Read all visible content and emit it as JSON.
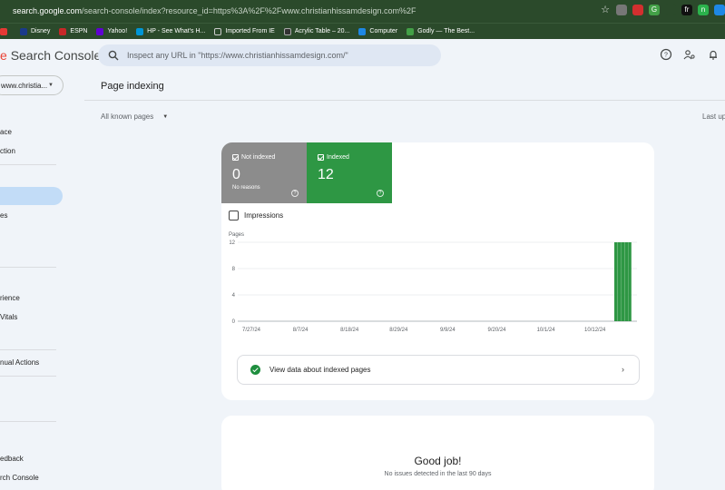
{
  "browser": {
    "url_host": "search.google.com",
    "url_rest": "/search-console/index?resource_id=https%3A%2F%2Fwww.christianhissamdesign.com%2F",
    "bookmarks": [
      {
        "label": "Disney",
        "color": "#1a3a8a"
      },
      {
        "label": "ESPN",
        "color": "#c62828"
      },
      {
        "label": "Yahoo!",
        "color": "#6001d2"
      },
      {
        "label": "HP - See What's H...",
        "color": "#0096d6"
      },
      {
        "label": "Imported From IE",
        "color": "#9aa0a6"
      },
      {
        "label": "Acrylic Table – 20...",
        "color": "#333333"
      },
      {
        "label": "Computer",
        "color": "#1e88e5"
      },
      {
        "label": "Godly — The Best...",
        "color": "#43a047"
      }
    ]
  },
  "header": {
    "app_name": "Search Console",
    "search_placeholder": "Inspect any URL in \"https://www.christianhissamdesign.com/\""
  },
  "sidebar": {
    "property": "www.christia...",
    "items": [
      "ace",
      "ction",
      "es",
      "rience",
      "Vitals",
      "nual Actions",
      "edback",
      "rch Console"
    ]
  },
  "main": {
    "page_title": "Page indexing",
    "filter_label": "All known pages",
    "last_updated_label": "Last up",
    "tiles": {
      "not_indexed": {
        "label": "Not indexed",
        "value": "0",
        "sub": "No reasons"
      },
      "indexed": {
        "label": "Indexed",
        "value": "12"
      }
    },
    "impressions_label": "Impressions",
    "view_data_label": "View data about indexed pages",
    "good_job": "Good job!",
    "no_issues": "No issues detected in the last 90 days"
  },
  "colors": {
    "indexed_green": "#2e9744",
    "not_indexed_gray": "#8c8c8c",
    "browser_frame": "#2b4a2b"
  },
  "chart_data": {
    "type": "bar",
    "ylabel": "Pages",
    "yticks": [
      0,
      4,
      8,
      12
    ],
    "ylim": [
      0,
      12
    ],
    "xticks": [
      "7/27/24",
      "8/7/24",
      "8/18/24",
      "8/29/24",
      "9/9/24",
      "9/20/24",
      "10/1/24",
      "10/12/24"
    ],
    "series": [
      {
        "name": "Indexed",
        "color": "#2e9744",
        "values_last_days": [
          12,
          12,
          12,
          12,
          12
        ]
      }
    ]
  }
}
